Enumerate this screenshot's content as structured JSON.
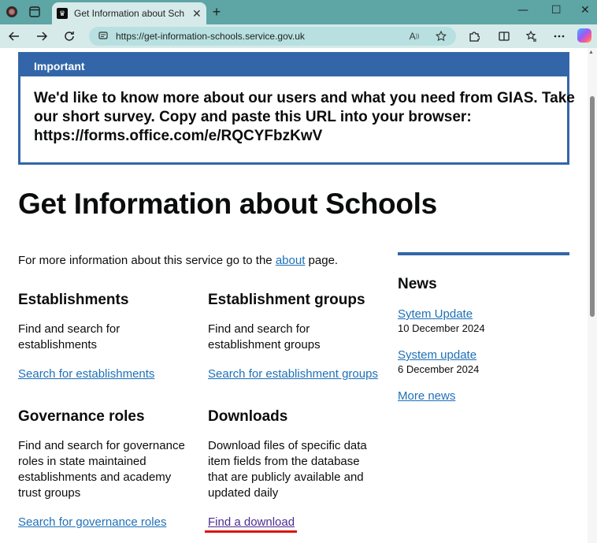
{
  "browser": {
    "tab_title": "Get Information about Schools - G",
    "url": "https://get-information-schools.service.gov.uk",
    "win_min": "—",
    "win_max": "☐",
    "win_close": "✕",
    "new_tab": "+",
    "tab_close": "✕"
  },
  "notice": {
    "heading": "Important",
    "lines": [
      "We'd like to know more about our users and what you need from GIAS. Take",
      "our short survey. Copy and paste this URL into your browser:",
      "https://forms.office.com/e/RQCYFbzKwV"
    ]
  },
  "page": {
    "title": "Get Information about Schools",
    "intro_before": "For more information about this service go to the ",
    "intro_link": "about",
    "intro_after": " page."
  },
  "sections": {
    "establishments": {
      "title": "Establishments",
      "desc": [
        "Find and search for",
        "establishments"
      ],
      "link": "Search for establishments"
    },
    "groups": {
      "title": "Establishment groups",
      "desc": [
        "Find and search for",
        "establishment groups"
      ],
      "link": "Search for establishment groups"
    },
    "governance": {
      "title": "Governance roles",
      "desc": [
        "Find and search for governance",
        "roles in state maintained",
        "establishments and academy",
        "trust groups"
      ],
      "link": "Search for governance roles"
    },
    "downloads": {
      "title": "Downloads",
      "desc": [
        "Download files of specific data",
        "item fields from the database",
        "that are publicly available and",
        "updated daily"
      ],
      "link": "Find a download"
    }
  },
  "news": {
    "title": "News",
    "items": [
      {
        "title": "Sytem Update",
        "date": "10 December 2024"
      },
      {
        "title": "System update",
        "date": "6 December 2024"
      }
    ],
    "more": "More news"
  },
  "icons": {
    "back": "back-arrow-icon",
    "forward": "forward-arrow-icon",
    "refresh": "refresh-icon",
    "site_info": "site-info-icon",
    "read_aloud": "read-aloud-icon",
    "favorite": "favorite-star-icon",
    "extensions": "extensions-icon",
    "split_screen": "split-screen-icon",
    "favorites_bar": "favorites-icon",
    "more": "more-dots-icon",
    "copilot": "copilot-icon"
  },
  "colors": {
    "chrome": "#5ea5a5",
    "link": "#1d70b8",
    "visited": "#4c2c92",
    "notice": "#3366a8",
    "highlight": "#e01010"
  }
}
